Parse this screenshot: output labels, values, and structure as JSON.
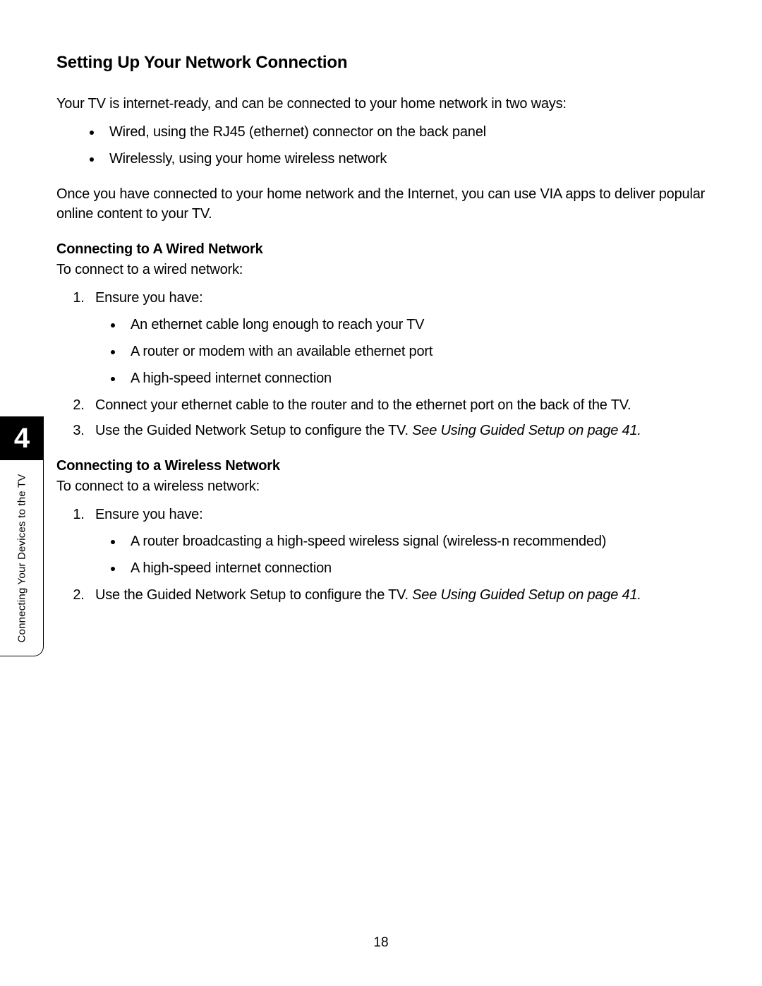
{
  "section_title": "Setting Up Your Network Connection",
  "intro_paragraph": "Your TV is internet-ready, and can be connected to your home network in two ways:",
  "intro_bullets": [
    "Wired, using the RJ45 (ethernet) connector on the back panel",
    "Wirelessly, using your home wireless network"
  ],
  "intro_paragraph_2": "Once you have connected to your home network and the Internet, you can use VIA apps to deliver popular online content to your TV.",
  "wired": {
    "title": "Connecting to A Wired Network",
    "intro": "To connect to a wired network:",
    "step1_text": "Ensure you have:",
    "step1_bullets": [
      "An ethernet cable long enough to reach your TV",
      "A router or modem with an available ethernet port",
      "A high-speed internet connection"
    ],
    "step2": "Connect your ethernet cable to the router and to the ethernet port on the back of the TV.",
    "step3_a": "Use the Guided Network Setup to configure the TV. ",
    "step3_b": "See Using Guided Setup on page 41."
  },
  "wireless": {
    "title": "Connecting to a Wireless Network",
    "intro": "To connect to a wireless network:",
    "step1_text": "Ensure you have:",
    "step1_bullets": [
      "A router broadcasting a high-speed wireless signal (wireless-n recommended)",
      "A high-speed internet connection"
    ],
    "step2_a": "Use the Guided Network Setup to configure the TV. ",
    "step2_b": "See Using Guided Setup on page 41."
  },
  "side_tab": {
    "chapter_number": "4",
    "chapter_label": "Connecting Your Devices to the TV"
  },
  "page_number": "18"
}
